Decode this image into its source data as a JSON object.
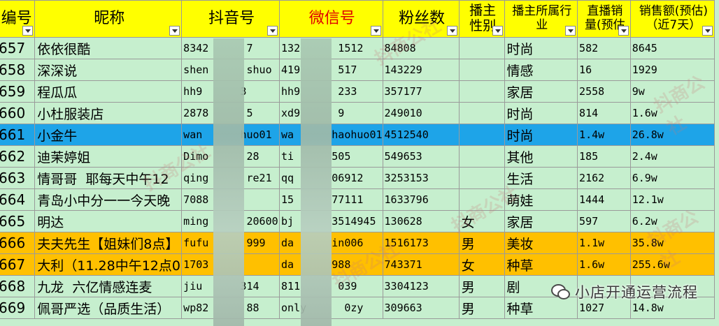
{
  "headers": [
    {
      "label": "编号",
      "cls": "big"
    },
    {
      "label": "昵称",
      "cls": "big"
    },
    {
      "label": "抖音号",
      "cls": "big"
    },
    {
      "label": "微信号",
      "cls": "big",
      "color": "#e00000"
    },
    {
      "label": "粉丝数",
      "cls": "big"
    },
    {
      "label": "播主\n性别",
      "cls": "mid"
    },
    {
      "label": "播主所属行\n业",
      "cls": "small"
    },
    {
      "label": "直播销\n量(预估",
      "cls": "small"
    },
    {
      "label": "销售额(预估)\n（近7天）",
      "cls": "small"
    }
  ],
  "rows": [
    {
      "style": "green",
      "cells": [
        "657",
        "依依很酷",
        "8342      7",
        "132      1512",
        "84808",
        "",
        "时尚",
        "582",
        "8645"
      ]
    },
    {
      "style": "green",
      "cells": [
        "658",
        "深深说",
        "shen      shuo",
        "419      517",
        "143229",
        "",
        "情感",
        "16",
        "1929"
      ]
    },
    {
      "style": "green",
      "cells": [
        "659",
        "程瓜瓜",
        "hh9      3",
        "hh9      233",
        "357177",
        "",
        "家居",
        "2558",
        "9w"
      ]
    },
    {
      "style": "green",
      "cells": [
        "660",
        "小杜服装店",
        "2878      5",
        "xd9      9",
        "249010",
        "",
        "时尚",
        "814",
        "1.6w"
      ]
    },
    {
      "style": "blue",
      "cells": [
        "661",
        "小金牛",
        "wan      huo01",
        "wa      haohuo01",
        "4512540",
        "",
        "时尚",
        "1.4w",
        "26.8w"
      ]
    },
    {
      "style": "green",
      "cells": [
        "662",
        "迪茉婷姐",
        "Dimo      28",
        "ti      505",
        "549653",
        "",
        "其他",
        "185",
        "2.4w"
      ]
    },
    {
      "style": "green",
      "cells": [
        "663",
        "情哥哥  耶每天中午12",
        "qing      re21",
        "qq      06912",
        "3253153",
        "",
        "生活",
        "2162",
        "6.9w"
      ]
    },
    {
      "style": "green",
      "cells": [
        "664",
        "青岛小中分一一今天晚",
        "7088      ",
        "15      77111",
        "1633796",
        "",
        "萌娃",
        "1444",
        "12.1w"
      ]
    },
    {
      "style": "green",
      "cells": [
        "665",
        "明达",
        "ming      20600",
        "bj      3514945",
        "130628",
        "女",
        "家居",
        "597",
        "6.2w"
      ]
    },
    {
      "style": "orange",
      "cells": [
        "666",
        "夫夫先生【姐妹们8点】",
        "fufu      999",
        "da      in006",
        "1516173",
        "男",
        "美妆",
        "1.1w",
        "35.8w"
      ]
    },
    {
      "style": "orange",
      "cells": [
        "667",
        "大利（11.28中午12点0",
        "1703      ",
        "da      988",
        "743371",
        "女",
        "种草",
        "1.6w",
        "255.6w"
      ]
    },
    {
      "style": "green",
      "cells": [
        "668",
        "九龙  六亿情感连麦",
        "jiu      314",
        "811      039",
        "3304123",
        "男",
        "剧",
        "",
        ""
      ]
    },
    {
      "style": "green",
      "cells": [
        "669",
        "佩哥严选（品质生活）",
        "wp82      88",
        "only      0zy",
        "309663",
        "男",
        "种草",
        "1027",
        "14.8w"
      ]
    }
  ],
  "watermark_text": "小店开通运营流程",
  "watermarks": [
    "抖商公社",
    "抖商公社",
    "抖商公社",
    "抖商公社",
    "抖商公社",
    "抖商公社"
  ]
}
